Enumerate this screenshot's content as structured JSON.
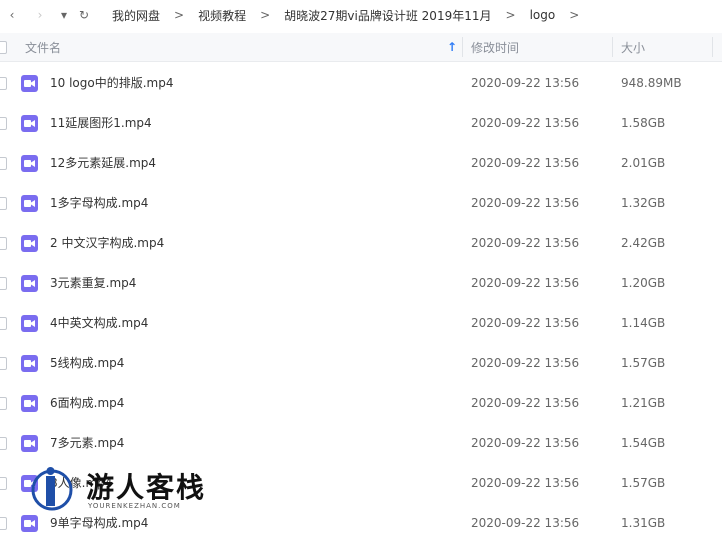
{
  "nav": {
    "back": "‹",
    "forward": "›",
    "dropdown": "▾",
    "refresh": "↻"
  },
  "breadcrumb": [
    "我的网盘",
    "视频教程",
    "胡晓波27期vi品牌设计班 2019年11月",
    "logo"
  ],
  "breadcrumb_sep": ">",
  "columns": {
    "name": "文件名",
    "modified": "修改时间",
    "size": "大小",
    "sort_arrow": "↑"
  },
  "colors": {
    "file_icon": "#7a6cf0",
    "sort_arrow": "#2f7cf6"
  },
  "files": [
    {
      "name": "10 logo中的排版.mp4",
      "modified": "2020-09-22 13:56",
      "size": "948.89MB"
    },
    {
      "name": "11延展图形1.mp4",
      "modified": "2020-09-22 13:56",
      "size": "1.58GB"
    },
    {
      "name": "12多元素延展.mp4",
      "modified": "2020-09-22 13:56",
      "size": "2.01GB"
    },
    {
      "name": "1多字母构成.mp4",
      "modified": "2020-09-22 13:56",
      "size": "1.32GB"
    },
    {
      "name": "2 中文汉字构成.mp4",
      "modified": "2020-09-22 13:56",
      "size": "2.42GB"
    },
    {
      "name": "3元素重复.mp4",
      "modified": "2020-09-22 13:56",
      "size": "1.20GB"
    },
    {
      "name": "4中英文构成.mp4",
      "modified": "2020-09-22 13:56",
      "size": "1.14GB"
    },
    {
      "name": "5线构成.mp4",
      "modified": "2020-09-22 13:56",
      "size": "1.57GB"
    },
    {
      "name": "6面构成.mp4",
      "modified": "2020-09-22 13:56",
      "size": "1.21GB"
    },
    {
      "name": "7多元素.mp4",
      "modified": "2020-09-22 13:56",
      "size": "1.54GB"
    },
    {
      "name": "8人像.mp4",
      "modified": "2020-09-22 13:56",
      "size": "1.57GB"
    },
    {
      "name": "9单字母构成.mp4",
      "modified": "2020-09-22 13:56",
      "size": "1.31GB"
    }
  ],
  "watermark": {
    "title": "游人客栈",
    "subtitle": "YOURENKEZHAN.COM"
  }
}
